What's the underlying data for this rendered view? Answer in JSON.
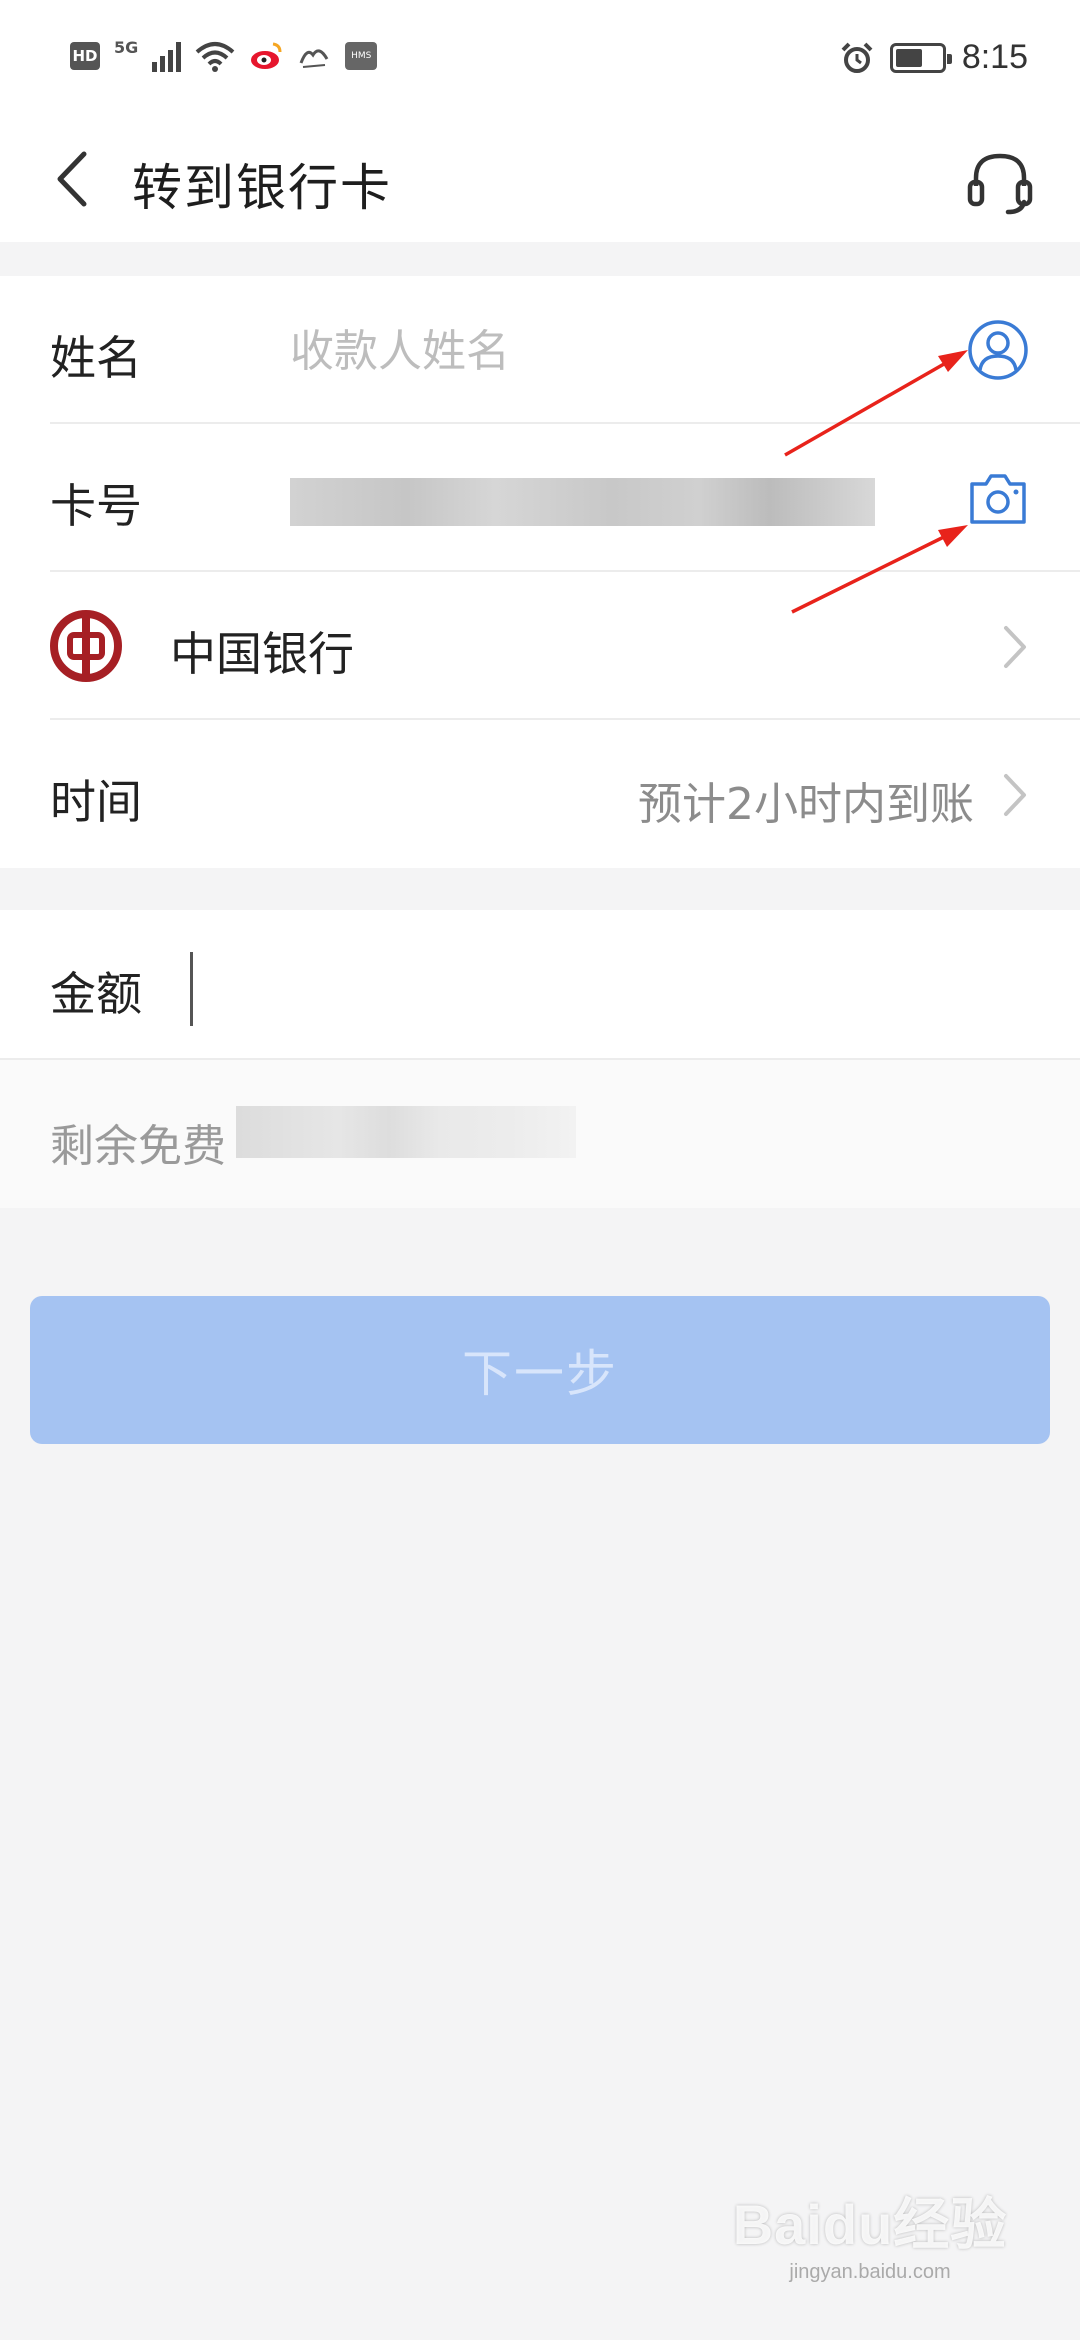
{
  "status_bar": {
    "hd": "HD",
    "network": "5G",
    "hms": "HMS",
    "battery_level": 0.6,
    "time": "8:15"
  },
  "header": {
    "title": "转到银行卡",
    "back_icon": "chevron-left-icon",
    "support_icon": "headset-icon"
  },
  "form": {
    "name": {
      "label": "姓名",
      "placeholder": "收款人姓名",
      "value": "",
      "icon": "contact-icon"
    },
    "card": {
      "label": "卡号",
      "value": "",
      "icon": "camera-icon"
    },
    "bank": {
      "name": "中国银行",
      "logo": "bank-of-china-logo"
    },
    "time": {
      "label": "时间",
      "value": "预计2小时内到账"
    },
    "amount": {
      "label": "金额",
      "value": ""
    },
    "fee": {
      "text": "剩余免费"
    }
  },
  "actions": {
    "next_label": "下一步"
  },
  "watermark": {
    "brand": "Baidu经验",
    "url": "jingyan.baidu.com"
  },
  "colors": {
    "accent": "#3a7bd5",
    "button_disabled": "#a5c3f2",
    "bank_red": "#a61f24",
    "annotation_red": "#e8231b"
  }
}
